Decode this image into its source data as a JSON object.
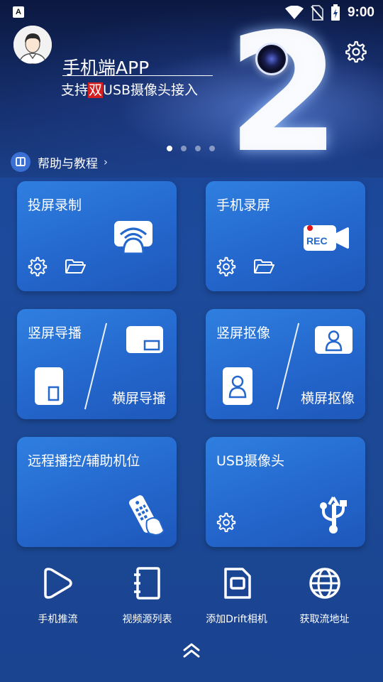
{
  "status": {
    "time": "9:00",
    "app_badge": "A"
  },
  "banner": {
    "title": "手机端APP",
    "subtitle_pre": "支持",
    "subtitle_highlight": "双",
    "subtitle_post": "USB摄像头接入",
    "big_number": "2",
    "slide_count": 4,
    "active_slide": 1
  },
  "help": {
    "label": "帮助与教程",
    "arrow": "›"
  },
  "cards": [
    {
      "title": "投屏录制"
    },
    {
      "title": "手机录屏",
      "rec_text": "REC"
    },
    {
      "title": "竖屏导播",
      "title2": "横屏导播"
    },
    {
      "title": "竖屏抠像",
      "title2": "横屏抠像"
    },
    {
      "title": "远程播控/辅助机位"
    },
    {
      "title": "USB摄像头"
    }
  ],
  "actions": [
    {
      "label": "手机推流",
      "icon": "play-triangle-icon"
    },
    {
      "label": "视频源列表",
      "icon": "notebook-icon"
    },
    {
      "label": "添加Drift相机",
      "icon": "camera-box-icon"
    },
    {
      "label": "获取流地址",
      "icon": "globe-icon"
    }
  ],
  "colors": {
    "card": "#2467cd",
    "background": "#1d4a9c",
    "rec_red": "#e01515"
  }
}
